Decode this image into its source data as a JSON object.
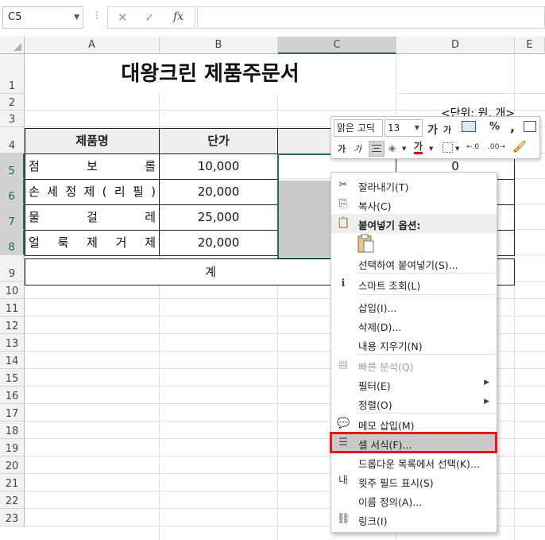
{
  "formula_bar": {
    "name_box": "C5",
    "separator": "⋮",
    "cancel": "✕",
    "enter": "✓",
    "fx": "fx",
    "value": ""
  },
  "columns": [
    "A",
    "B",
    "C",
    "D",
    "E"
  ],
  "rows": [
    "1",
    "2",
    "3",
    "4",
    "5",
    "6",
    "7",
    "8",
    "9",
    "10",
    "11",
    "12",
    "13",
    "14",
    "15",
    "16",
    "17",
    "18",
    "19",
    "20",
    "21",
    "22",
    "23"
  ],
  "sheet": {
    "title": "대왕크린 제품주문서",
    "unit_note": "<단위: 원, 개>",
    "header_name": "제품명",
    "header_price": "단가",
    "header_qty_partial": "수",
    "products": [
      {
        "name": [
          "점",
          "보",
          "롤"
        ],
        "price": "10,000"
      },
      {
        "name": [
          "손",
          "세",
          "정",
          "제",
          "(",
          "리",
          "필",
          ")"
        ],
        "price": "20,000"
      },
      {
        "name": [
          "물",
          "걸",
          "레"
        ],
        "price": "25,000"
      },
      {
        "name": [
          "얼",
          "룩",
          "제",
          "거",
          "제"
        ],
        "price": "20,000"
      }
    ],
    "d5_value": "0",
    "total_label": "계"
  },
  "mini_toolbar": {
    "font": "맑은 고딕",
    "size": "13",
    "grow_font": "가",
    "shrink_font": "가",
    "percent": "%",
    "comma": ",",
    "bold": "가",
    "italic": "가",
    "font_color_label": "가",
    "inc_decimal": "←.0",
    "dec_decimal": ".00→"
  },
  "context_menu": {
    "items": [
      {
        "label": "잘라내기(T)",
        "icon": "scissors-icon",
        "glyph": "✂",
        "disabled": false
      },
      {
        "label": "복사(C)",
        "icon": "copy-icon",
        "glyph": "⎘",
        "disabled": false
      },
      {
        "label": "붙여넣기 옵션:",
        "icon": "paste-options-icon",
        "glyph": "📋",
        "disabled": false
      },
      {
        "label": "선택하여 붙여넣기(S)...",
        "icon": "",
        "glyph": "",
        "disabled": false
      },
      {
        "label": "스마트 조회(L)",
        "icon": "smart-lookup-icon",
        "glyph": "ℹ",
        "disabled": false
      },
      {
        "label": "삽입(I)...",
        "icon": "",
        "glyph": "",
        "disabled": false
      },
      {
        "label": "삭제(D)...",
        "icon": "",
        "glyph": "",
        "disabled": false
      },
      {
        "label": "내용 지우기(N)",
        "icon": "",
        "glyph": "",
        "disabled": false
      },
      {
        "label": "빠른 분석(Q)",
        "icon": "quick-analysis-icon",
        "glyph": "▤",
        "disabled": true
      },
      {
        "label": "필터(E)",
        "icon": "",
        "glyph": "",
        "disabled": false,
        "submenu": true
      },
      {
        "label": "정렬(O)",
        "icon": "",
        "glyph": "",
        "disabled": false,
        "submenu": true
      },
      {
        "label": "메모 삽입(M)",
        "icon": "insert-comment-icon",
        "glyph": "💬",
        "disabled": false
      },
      {
        "label": "셀 서식(F)...",
        "icon": "format-cells-icon",
        "glyph": "☰",
        "disabled": false,
        "highlighted": true
      },
      {
        "label": "드롭다운 목록에서 선택(K)...",
        "icon": "",
        "glyph": "",
        "disabled": false
      },
      {
        "label": "윗주 필드 표시(S)",
        "icon": "phonetic-icon",
        "glyph": "내",
        "disabled": false
      },
      {
        "label": "이름 정의(A)...",
        "icon": "",
        "glyph": "",
        "disabled": false
      },
      {
        "label": "링크(I)",
        "icon": "link-icon",
        "glyph": "⛓",
        "disabled": false
      }
    ]
  },
  "colors": {
    "accent": "#217346",
    "highlight_box": "#e8141c",
    "header_fill": "#eeeeee",
    "selected_fill": "#c8c8c8"
  }
}
